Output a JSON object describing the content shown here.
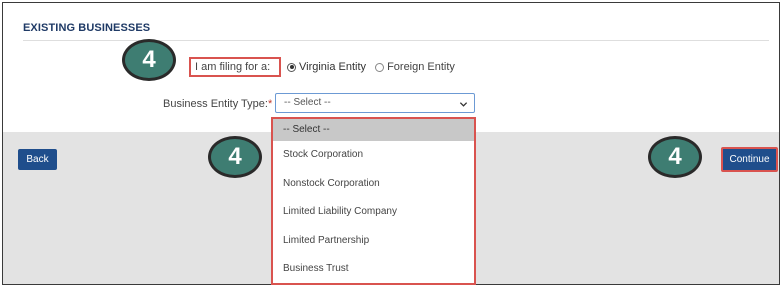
{
  "section": {
    "title": "EXISTING BUSINESSES"
  },
  "filing": {
    "label": "I am filing for a:",
    "options": [
      {
        "label": "Virginia Entity",
        "checked": true
      },
      {
        "label": "Foreign Entity",
        "checked": false
      }
    ]
  },
  "entity_type": {
    "label": "Business Entity Type:",
    "required_mark": "*",
    "selected": "-- Select --",
    "options": [
      "-- Select --",
      "Stock Corporation",
      "Nonstock Corporation",
      "Limited Liability Company",
      "Limited Partnership",
      "Business Trust"
    ]
  },
  "buttons": {
    "back": "Back",
    "continue": "Continue"
  },
  "step_badges": [
    "4",
    "4",
    "4"
  ],
  "colors": {
    "accent": "#1f4e8c",
    "highlight": "#d9534f",
    "badge": "#3e7d72",
    "title": "#1f3a66"
  }
}
